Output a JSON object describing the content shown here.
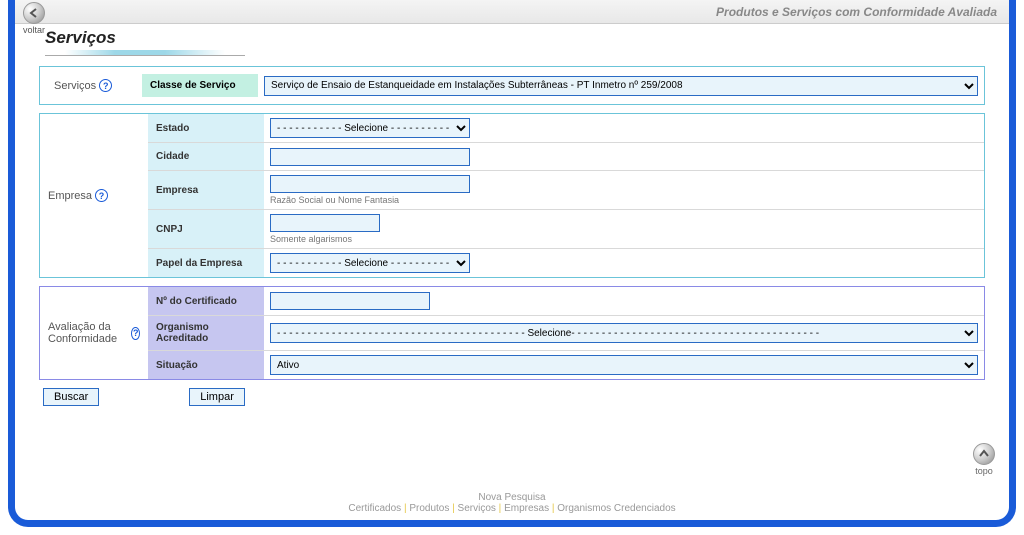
{
  "header": {
    "title": "Produtos e Serviços com Conformidade Avaliada",
    "back_label": "voltar"
  },
  "page_title": "Serviços",
  "servicos": {
    "section_label": "Serviços",
    "classe_label": "Classe de Serviço",
    "classe_selected": "Serviço de Ensaio de Estanqueidade em Instalações Subterrâneas - PT Inmetro nº 259/2008"
  },
  "empresa": {
    "section_label": "Empresa",
    "estado_label": "Estado",
    "estado_selected": "- - - - - - - - - - - Selecione - - - - - - - - - - -",
    "cidade_label": "Cidade",
    "cidade_value": "",
    "empresa_label": "Empresa",
    "empresa_value": "",
    "empresa_hint": "Razão Social ou Nome Fantasia",
    "cnpj_label": "CNPJ",
    "cnpj_value": "",
    "cnpj_hint": "Somente algarismos",
    "papel_label": "Papel da Empresa",
    "papel_selected": "- - - - - - - - - - - Selecione - - - - - - - - - - -"
  },
  "conformidade": {
    "section_label": "Avaliação da Conformidade",
    "cert_label": "Nº do Certificado",
    "cert_value": "",
    "org_label": "Organismo Acreditado",
    "org_selected": "- - - - - - - - - - - - - - - - - - - - - - - - - - - - - - - - - - - - - - - - - Selecione- - - - - - - - - - - - - - - - - - - - - - - - - - - - - - - - - - - - - - - - -",
    "sit_label": "Situação",
    "sit_selected": "Ativo"
  },
  "buttons": {
    "buscar": "Buscar",
    "limpar": "Limpar"
  },
  "topo_label": "topo",
  "footer": {
    "nova": "Nova Pesquisa",
    "links": [
      "Certificados",
      "Produtos",
      "Serviços",
      "Empresas",
      "Organismos Credenciados"
    ]
  }
}
